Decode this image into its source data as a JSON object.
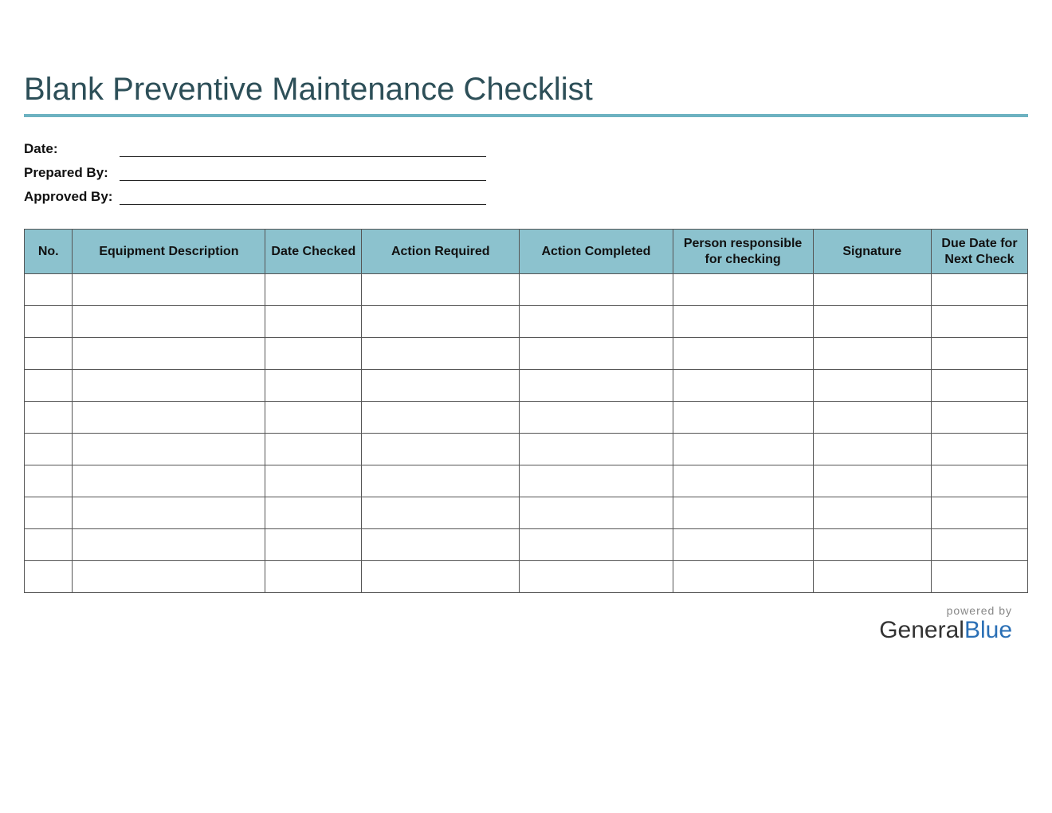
{
  "title": "Blank Preventive Maintenance Checklist",
  "meta": {
    "date_label": "Date:",
    "prepared_label": "Prepared By:",
    "approved_label": "Approved By:",
    "date_value": "",
    "prepared_value": "",
    "approved_value": ""
  },
  "table": {
    "headers": {
      "no": "No.",
      "equipment": "Equipment Description",
      "date_checked": "Date Checked",
      "action_required": "Action Required",
      "action_completed": "Action Completed",
      "person_responsible": "Person responsible for checking",
      "signature": "Signature",
      "due_date": "Due Date for Next Check"
    },
    "rows": [
      {
        "no": "",
        "equipment": "",
        "date_checked": "",
        "action_required": "",
        "action_completed": "",
        "person_responsible": "",
        "signature": "",
        "due_date": ""
      },
      {
        "no": "",
        "equipment": "",
        "date_checked": "",
        "action_required": "",
        "action_completed": "",
        "person_responsible": "",
        "signature": "",
        "due_date": ""
      },
      {
        "no": "",
        "equipment": "",
        "date_checked": "",
        "action_required": "",
        "action_completed": "",
        "person_responsible": "",
        "signature": "",
        "due_date": ""
      },
      {
        "no": "",
        "equipment": "",
        "date_checked": "",
        "action_required": "",
        "action_completed": "",
        "person_responsible": "",
        "signature": "",
        "due_date": ""
      },
      {
        "no": "",
        "equipment": "",
        "date_checked": "",
        "action_required": "",
        "action_completed": "",
        "person_responsible": "",
        "signature": "",
        "due_date": ""
      },
      {
        "no": "",
        "equipment": "",
        "date_checked": "",
        "action_required": "",
        "action_completed": "",
        "person_responsible": "",
        "signature": "",
        "due_date": ""
      },
      {
        "no": "",
        "equipment": "",
        "date_checked": "",
        "action_required": "",
        "action_completed": "",
        "person_responsible": "",
        "signature": "",
        "due_date": ""
      },
      {
        "no": "",
        "equipment": "",
        "date_checked": "",
        "action_required": "",
        "action_completed": "",
        "person_responsible": "",
        "signature": "",
        "due_date": ""
      },
      {
        "no": "",
        "equipment": "",
        "date_checked": "",
        "action_required": "",
        "action_completed": "",
        "person_responsible": "",
        "signature": "",
        "due_date": ""
      },
      {
        "no": "",
        "equipment": "",
        "date_checked": "",
        "action_required": "",
        "action_completed": "",
        "person_responsible": "",
        "signature": "",
        "due_date": ""
      }
    ]
  },
  "footer": {
    "powered_by": "powered by",
    "brand_general": "General",
    "brand_blue": "Blue"
  },
  "colors": {
    "accent": "#6db2c1",
    "header_bg": "#8cc2ce",
    "title_color": "#2d4f58"
  }
}
